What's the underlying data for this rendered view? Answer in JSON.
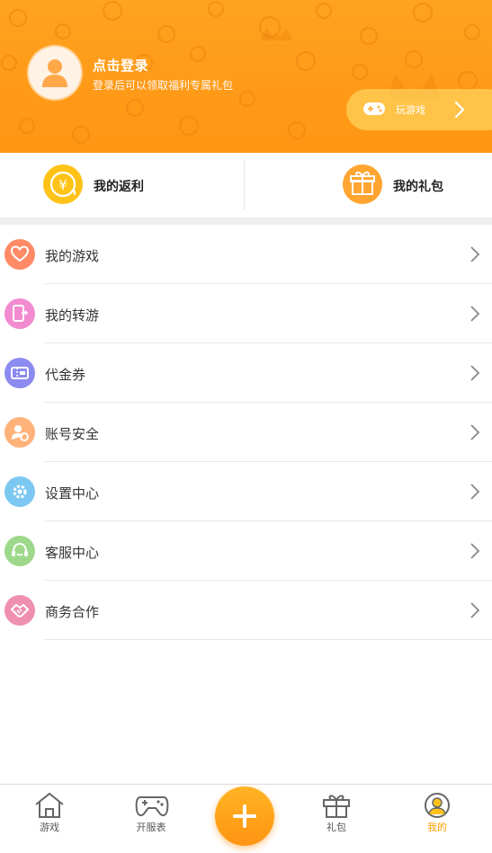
{
  "header": {
    "login_title": "点击登录",
    "login_subtitle": "登录后可以领取福利专属礼包",
    "play_label": "玩游戏",
    "background_color": "#FFA320"
  },
  "quick": {
    "rebate_label": "我的返利",
    "gift_label": "我的礼包"
  },
  "menu": {
    "items": [
      {
        "label": "我的游戏",
        "icon": "heart-icon",
        "color": "#FF8A66"
      },
      {
        "label": "我的转游",
        "icon": "transfer-phone-icon",
        "color": "#F28BD0"
      },
      {
        "label": "代金券",
        "icon": "ticket-icon",
        "color": "#8C8BF0"
      },
      {
        "label": "账号安全",
        "icon": "user-shield-icon",
        "color": "#FFB27A"
      },
      {
        "label": "设置中心",
        "icon": "gear-icon",
        "color": "#7CC8F2"
      },
      {
        "label": "客服中心",
        "icon": "headset-icon",
        "color": "#9ED98B"
      },
      {
        "label": "商务合作",
        "icon": "handshake-icon",
        "color": "#F090B0"
      }
    ]
  },
  "nav": {
    "tabs": [
      {
        "label": "游戏",
        "icon": "home-icon"
      },
      {
        "label": "开服表",
        "icon": "gamepad-icon"
      },
      {
        "label": "礼包",
        "icon": "gift-icon"
      },
      {
        "label": "我的",
        "icon": "profile-icon",
        "active": true
      }
    ],
    "accent_color": "#FFA000"
  }
}
